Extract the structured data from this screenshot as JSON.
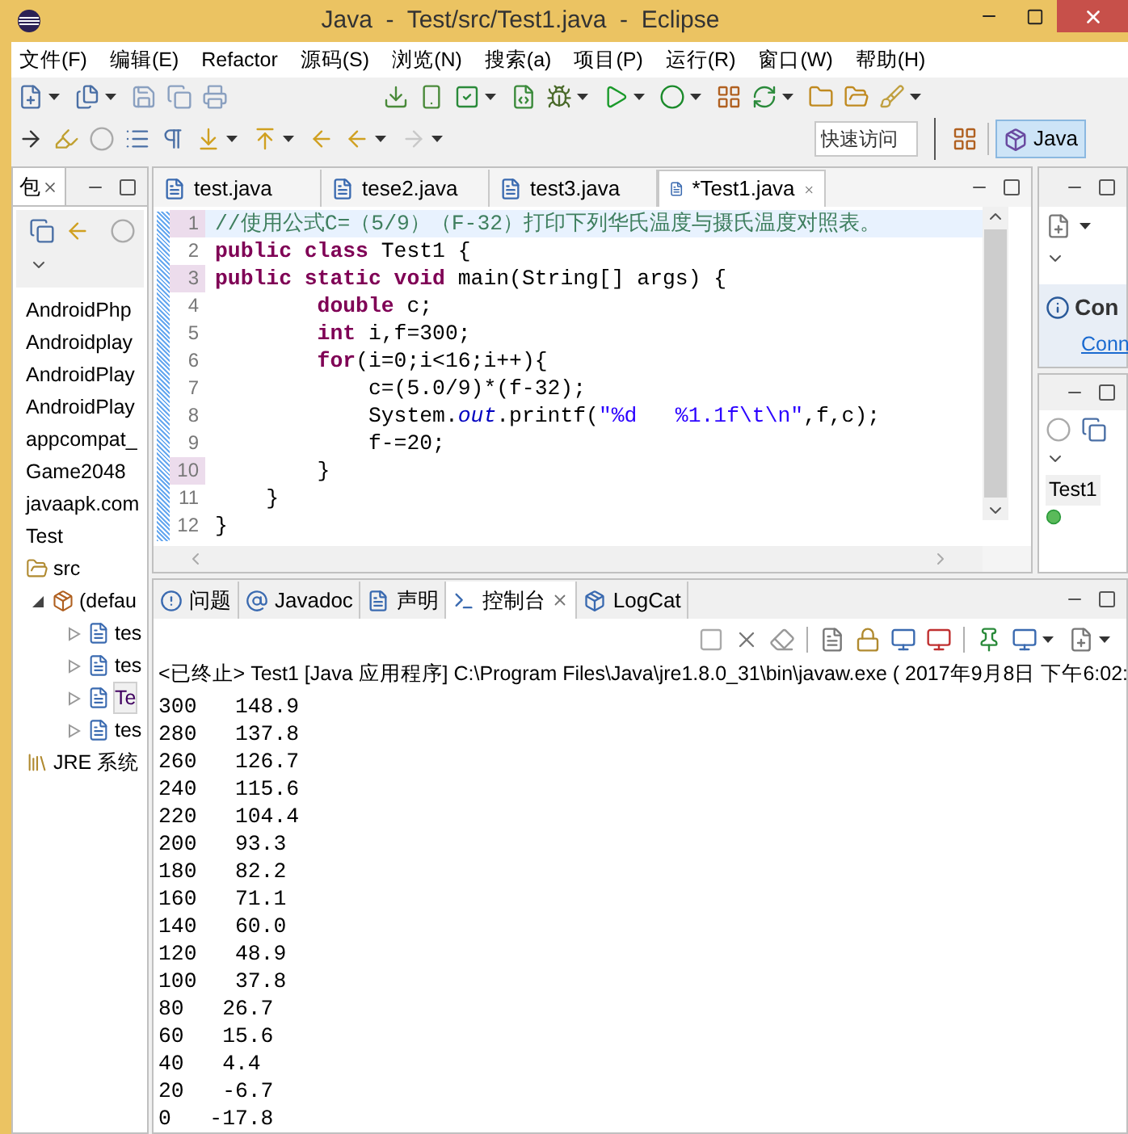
{
  "window": {
    "title": "Java  -  Test/src/Test1.java  -  Eclipse"
  },
  "menu": [
    "文件(F)",
    "编辑(E)",
    "Refactor",
    "源码(S)",
    "浏览(N)",
    "搜索(a)",
    "项目(P)",
    "运行(R)",
    "窗口(W)",
    "帮助(H)"
  ],
  "quick_access": {
    "placeholder": "快速访问"
  },
  "perspective": {
    "label": "Java",
    "selected": true
  },
  "package_explorer": {
    "tab": {
      "label": "包",
      "selected": true
    },
    "items": [
      {
        "label": "AndroidPhp"
      },
      {
        "label": "Androidplay"
      },
      {
        "label": "AndroidPlay"
      },
      {
        "label": "AndroidPlay"
      },
      {
        "label": "appcompat_"
      },
      {
        "label": "Game2048"
      },
      {
        "label": "javaapk.com"
      },
      {
        "label": "Test",
        "children": [
          {
            "label": "src",
            "children": [
              {
                "label": "(defau",
                "expanded": true,
                "children": [
                  {
                    "label": "tes",
                    "expanded": false,
                    "selected": false
                  },
                  {
                    "label": "tes",
                    "expanded": false,
                    "selected": false
                  },
                  {
                    "label": "Te",
                    "expanded": false,
                    "selected": true
                  },
                  {
                    "label": "tes",
                    "expanded": false,
                    "selected": false
                  }
                ]
              }
            ]
          },
          {
            "label": "JRE 系统"
          }
        ]
      }
    ]
  },
  "editor": {
    "tabs": [
      {
        "label": "test.java",
        "selected": false
      },
      {
        "label": "tese2.java",
        "selected": false
      },
      {
        "label": "test3.java",
        "selected": false
      },
      {
        "label": "*Test1.java",
        "selected": true
      }
    ],
    "lines": [
      {
        "number": "1",
        "current": true,
        "changed": true,
        "tokens": [
          {
            "kind": "comment",
            "text": "//使用公式C=（5/9）（F-32）打印下列华氏温度与摄氏温度对照表。"
          }
        ]
      },
      {
        "number": "2",
        "current": false,
        "changed": false,
        "tokens": [
          {
            "kind": "keyword",
            "text": "public"
          },
          {
            "kind": "keyword",
            "text": " class"
          },
          {
            "kind": "plain",
            "text": " Test1 {"
          }
        ]
      },
      {
        "number": "3",
        "current": false,
        "changed": true,
        "tokens": [
          {
            "kind": "keyword",
            "text": "public"
          },
          {
            "kind": "keyword",
            "text": " static"
          },
          {
            "kind": "keyword",
            "text": " void"
          },
          {
            "kind": "plain",
            "text": " main(String[] args) {"
          }
        ]
      },
      {
        "number": "4",
        "current": false,
        "changed": false,
        "tokens": [
          {
            "kind": "keyword",
            "text": "        double"
          },
          {
            "kind": "plain",
            "text": " c;"
          }
        ]
      },
      {
        "number": "5",
        "current": false,
        "changed": false,
        "tokens": [
          {
            "kind": "keyword",
            "text": "        int"
          },
          {
            "kind": "plain",
            "text": " i,f=300;"
          }
        ]
      },
      {
        "number": "6",
        "current": false,
        "changed": false,
        "tokens": [
          {
            "kind": "keyword",
            "text": "        for"
          },
          {
            "kind": "plain",
            "text": "(i=0;i<16;i++){"
          }
        ]
      },
      {
        "number": "7",
        "current": false,
        "changed": false,
        "tokens": [
          {
            "kind": "plain",
            "text": "            c=(5.0/9)*(f-32);"
          }
        ]
      },
      {
        "number": "8",
        "current": false,
        "changed": false,
        "tokens": [
          {
            "kind": "plain",
            "text": "            System."
          },
          {
            "kind": "field",
            "text": "out"
          },
          {
            "kind": "plain",
            "text": ".printf("
          },
          {
            "kind": "string",
            "text": "\"%d   %1.1f\\t\\n\""
          },
          {
            "kind": "plain",
            "text": ",f,c);"
          }
        ]
      },
      {
        "number": "9",
        "current": false,
        "changed": false,
        "tokens": [
          {
            "kind": "plain",
            "text": "            f-=20;"
          }
        ]
      },
      {
        "number": "10",
        "current": false,
        "changed": true,
        "tokens": [
          {
            "kind": "plain",
            "text": "        }"
          }
        ]
      },
      {
        "number": "11",
        "current": false,
        "changed": false,
        "tokens": [
          {
            "kind": "plain",
            "text": "    }"
          }
        ]
      },
      {
        "number": "12",
        "current": false,
        "changed": false,
        "tokens": [
          {
            "kind": "plain",
            "text": "}"
          }
        ]
      }
    ]
  },
  "right_top": {
    "info_title": "Con",
    "link": "Conn"
  },
  "right_bottom": {
    "item": "Test1"
  },
  "console": {
    "tabs": [
      {
        "label": "问题",
        "selected": false
      },
      {
        "label": "Javadoc",
        "selected": false
      },
      {
        "label": "声明",
        "selected": false
      },
      {
        "label": "控制台",
        "selected": true
      },
      {
        "label": "LogCat",
        "selected": false
      }
    ],
    "header": "<已终止> Test1 [Java 应用程序] C:\\Program Files\\Java\\jre1.8.0_31\\bin\\javaw.exe ( 2017年9月8日 下午6:02:",
    "lines": [
      "300   148.9",
      "280   137.8",
      "260   126.7",
      "240   115.6",
      "220   104.4",
      "200   93.3",
      "180   82.2",
      "160   71.1",
      "140   60.0",
      "120   48.9",
      "100   37.8",
      "80   26.7",
      "60   15.6",
      "40   4.4",
      "20   -6.7",
      "0   -17.8"
    ]
  }
}
